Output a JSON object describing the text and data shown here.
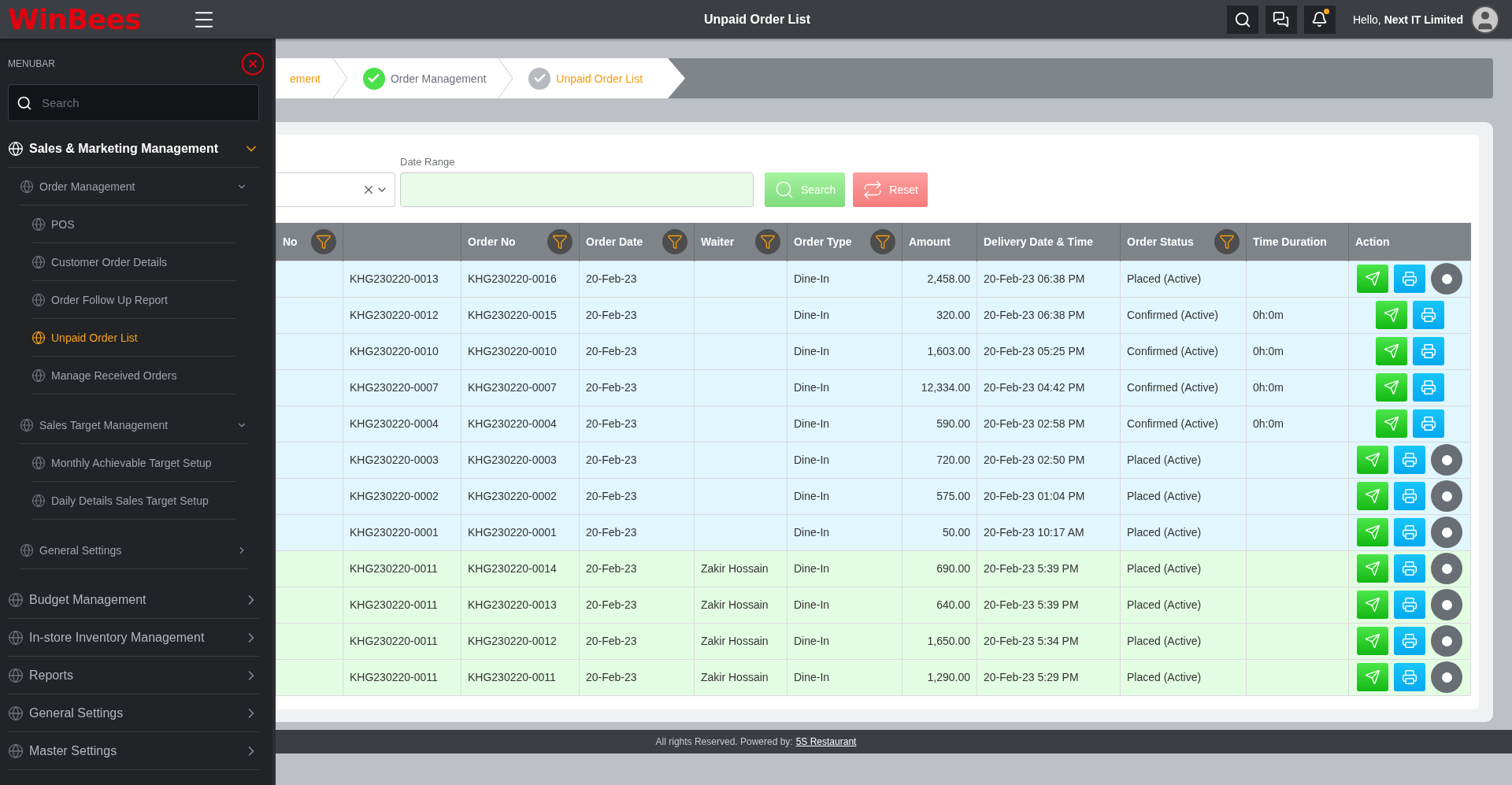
{
  "header": {
    "logo": "WinBees",
    "title": "Unpaid Order List",
    "greeting": "Hello, **Next IT Limited**",
    "has_notification": true
  },
  "sidebar": {
    "title": "MENUBAR",
    "search": {
      "placeholder": "Search"
    },
    "items": [
      {
        "label": "Sales & Marketing Management",
        "selected": false,
        "expanded": true,
        "children": [
          {
            "label": "Order Management",
            "selected": false,
            "expanded": true,
            "children": [
              {
                "label": "POS",
                "selected": false
              },
              {
                "label": "Customer Order Details",
                "selected": false
              },
              {
                "label": "Order Follow Up Report",
                "selected": false
              },
              {
                "label": "Unpaid Order List",
                "selected": true
              },
              {
                "label": "Manage Received Orders",
                "selected": false
              }
            ]
          },
          {
            "label": "Sales Target Management",
            "selected": false,
            "expanded": true,
            "children": [
              {
                "label": "Monthly Achievable Target Setup",
                "selected": false
              },
              {
                "label": "Daily Details Sales Target Setup",
                "selected": false
              }
            ]
          },
          {
            "label": "General Settings",
            "selected": false,
            "expanded": false
          }
        ]
      },
      {
        "label": "Budget Management",
        "selected": false,
        "expanded": false
      },
      {
        "label": "In-store Inventory Management",
        "selected": false,
        "expanded": false
      },
      {
        "label": "Reports",
        "selected": false,
        "expanded": false
      },
      {
        "label": "General Settings",
        "selected": false,
        "expanded": false
      },
      {
        "label": "Master Settings",
        "selected": false,
        "expanded": false
      }
    ]
  },
  "breadcrumb": [
    {
      "label": "ement",
      "kind": "link"
    },
    {
      "label": "Order Management",
      "kind": "done"
    },
    {
      "label": "Unpaid Order List",
      "kind": "current"
    }
  ],
  "filters": {
    "date_range": {
      "label": "Date Range"
    },
    "search_button": "Search",
    "reset_button": "Reset"
  },
  "table": {
    "columns": [
      {
        "label": "No",
        "filter": true
      },
      {
        "filter": false
      },
      {
        "label": "Order No",
        "filter": true
      },
      {
        "label": "Order Date",
        "filter": true
      },
      {
        "label": "Waiter",
        "filter": true
      },
      {
        "label": "Order Type",
        "filter": true
      },
      {
        "label": "Amount",
        "filter": false
      },
      {
        "label": "Delivery Date & Time",
        "filter": false
      },
      {
        "label": "Order Status",
        "filter": true
      },
      {
        "label": "Time Duration",
        "filter": false
      },
      {
        "label": "Action",
        "filter": false
      }
    ],
    "rows": [
      {
        "color": "#e1f6fd",
        "column_2": "KHG230220-0013",
        "order_no": "KHG230220-0016",
        "order_date": "20-Feb-23",
        "order_type": "Dine-In",
        "amount": "2,458.00",
        "delivery": "20-Feb-23 06:38 PM",
        "status": "Placed (Active)",
        "dot_button": true
      },
      {
        "color": "#e1f6fd",
        "column_2": "KHG230220-0012",
        "order_no": "KHG230220-0015",
        "order_date": "20-Feb-23",
        "order_type": "Dine-In",
        "amount": "320.00",
        "delivery": "20-Feb-23 06:38 PM",
        "status": "Confirmed (Active)",
        "duration": "0h:0m",
        "dot_button": false
      },
      {
        "color": "#e1f6fd",
        "column_2": "KHG230220-0010",
        "order_no": "KHG230220-0010",
        "order_date": "20-Feb-23",
        "order_type": "Dine-In",
        "amount": "1,603.00",
        "delivery": "20-Feb-23 05:25 PM",
        "status": "Confirmed (Active)",
        "duration": "0h:0m",
        "dot_button": false
      },
      {
        "color": "#e1f6fd",
        "column_2": "KHG230220-0007",
        "order_no": "KHG230220-0007",
        "order_date": "20-Feb-23",
        "order_type": "Dine-In",
        "amount": "12,334.00",
        "delivery": "20-Feb-23 04:42 PM",
        "status": "Confirmed (Active)",
        "duration": "0h:0m",
        "dot_button": false
      },
      {
        "color": "#e1f6fd",
        "column_2": "KHG230220-0004",
        "order_no": "KHG230220-0004",
        "order_date": "20-Feb-23",
        "order_type": "Dine-In",
        "amount": "590.00",
        "delivery": "20-Feb-23 02:58 PM",
        "status": "Confirmed (Active)",
        "duration": "0h:0m",
        "dot_button": false
      },
      {
        "color": "#e1f6fd",
        "column_2": "KHG230220-0003",
        "order_no": "KHG230220-0003",
        "order_date": "20-Feb-23",
        "order_type": "Dine-In",
        "amount": "720.00",
        "delivery": "20-Feb-23 02:50 PM",
        "status": "Placed (Active)",
        "dot_button": true
      },
      {
        "color": "#e1f6fd",
        "column_2": "KHG230220-0002",
        "order_no": "KHG230220-0002",
        "order_date": "20-Feb-23",
        "order_type": "Dine-In",
        "amount": "575.00",
        "delivery": "20-Feb-23 01:04 PM",
        "status": "Placed (Active)",
        "dot_button": true
      },
      {
        "color": "#e1f6fd",
        "column_2": "KHG230220-0001",
        "order_no": "KHG230220-0001",
        "order_date": "20-Feb-23",
        "order_type": "Dine-In",
        "amount": "50.00",
        "delivery": "20-Feb-23 10:17 AM",
        "status": "Placed (Active)",
        "dot_button": true
      },
      {
        "color": "#e3fde2",
        "column_2": "KHG230220-0011",
        "order_no": "KHG230220-0014",
        "order_date": "20-Feb-23",
        "waiter": "Zakir Hossain",
        "order_type": "Dine-In",
        "amount": "690.00",
        "delivery": "20-Feb-23 5:39 PM",
        "status": "Placed (Active)",
        "dot_button": true
      },
      {
        "color": "#e3fde2",
        "column_2": "KHG230220-0011",
        "order_no": "KHG230220-0013",
        "order_date": "20-Feb-23",
        "waiter": "Zakir Hossain",
        "order_type": "Dine-In",
        "amount": "640.00",
        "delivery": "20-Feb-23 5:39 PM",
        "status": "Placed (Active)",
        "dot_button": true
      },
      {
        "color": "#e3fde2",
        "column_2": "KHG230220-0011",
        "order_no": "KHG230220-0012",
        "order_date": "20-Feb-23",
        "waiter": "Zakir Hossain",
        "order_type": "Dine-In",
        "amount": "1,650.00",
        "delivery": "20-Feb-23 5:34 PM",
        "status": "Placed (Active)",
        "dot_button": true
      },
      {
        "color": "#e3fde2",
        "column_2": "KHG230220-0011",
        "order_no": "KHG230220-0011",
        "order_date": "20-Feb-23",
        "waiter": "Zakir Hossain",
        "order_type": "Dine-In",
        "amount": "1,290.00",
        "delivery": "20-Feb-23 5:29 PM",
        "status": "Placed (Active)",
        "dot_button": true
      }
    ]
  },
  "footer": {
    "text": "All rights Reserved. Powered by:",
    "link": "5S Restaurant"
  }
}
